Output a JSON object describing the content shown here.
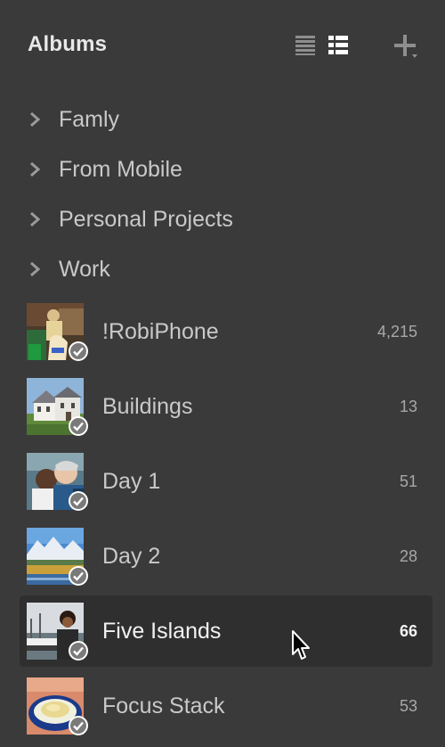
{
  "panel": {
    "title": "Albums",
    "view_buttons": [
      {
        "name": "list-view",
        "icon": "list-icon"
      },
      {
        "name": "detail-view",
        "icon": "detail-list-icon"
      }
    ],
    "add_icon": "plus-icon"
  },
  "folders": [
    {
      "label": "Famly"
    },
    {
      "label": "From Mobile"
    },
    {
      "label": "Personal Projects"
    },
    {
      "label": "Work"
    }
  ],
  "albums": [
    {
      "label": "!RobiPhone",
      "count": "4,215"
    },
    {
      "label": "Buildings",
      "count": "13"
    },
    {
      "label": "Day 1",
      "count": "51"
    },
    {
      "label": "Day 2",
      "count": "28"
    },
    {
      "label": "Five Islands",
      "count": "66",
      "selected": true
    },
    {
      "label": "Focus Stack",
      "count": "53"
    }
  ],
  "colors": {
    "background": "#3a3a3a",
    "selected_row": "#2f2f2f",
    "text": "#c9c9c9",
    "title": "#e8e8e8",
    "count": "#a8a8a8"
  }
}
